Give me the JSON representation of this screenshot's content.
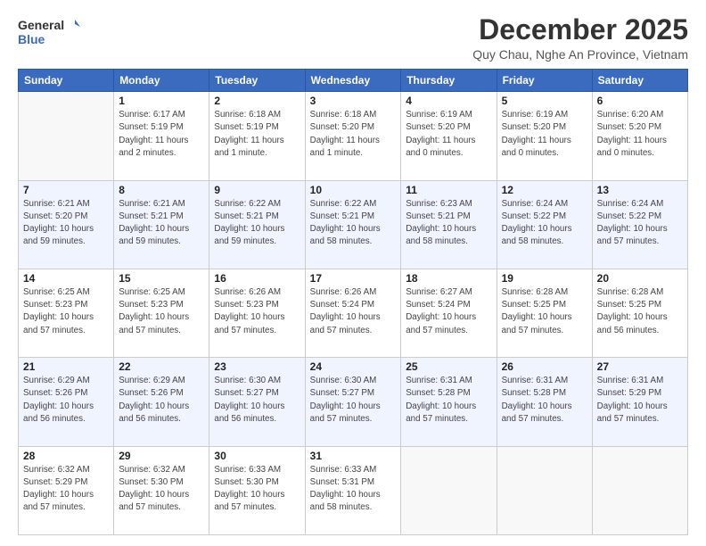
{
  "logo": {
    "line1": "General",
    "line2": "Blue"
  },
  "title": "December 2025",
  "subtitle": "Quy Chau, Nghe An Province, Vietnam",
  "days_header": [
    "Sunday",
    "Monday",
    "Tuesday",
    "Wednesday",
    "Thursday",
    "Friday",
    "Saturday"
  ],
  "weeks": [
    [
      {
        "num": "",
        "info": ""
      },
      {
        "num": "1",
        "info": "Sunrise: 6:17 AM\nSunset: 5:19 PM\nDaylight: 11 hours\nand 2 minutes."
      },
      {
        "num": "2",
        "info": "Sunrise: 6:18 AM\nSunset: 5:19 PM\nDaylight: 11 hours\nand 1 minute."
      },
      {
        "num": "3",
        "info": "Sunrise: 6:18 AM\nSunset: 5:20 PM\nDaylight: 11 hours\nand 1 minute."
      },
      {
        "num": "4",
        "info": "Sunrise: 6:19 AM\nSunset: 5:20 PM\nDaylight: 11 hours\nand 0 minutes."
      },
      {
        "num": "5",
        "info": "Sunrise: 6:19 AM\nSunset: 5:20 PM\nDaylight: 11 hours\nand 0 minutes."
      },
      {
        "num": "6",
        "info": "Sunrise: 6:20 AM\nSunset: 5:20 PM\nDaylight: 11 hours\nand 0 minutes."
      }
    ],
    [
      {
        "num": "7",
        "info": "Sunrise: 6:21 AM\nSunset: 5:20 PM\nDaylight: 10 hours\nand 59 minutes."
      },
      {
        "num": "8",
        "info": "Sunrise: 6:21 AM\nSunset: 5:21 PM\nDaylight: 10 hours\nand 59 minutes."
      },
      {
        "num": "9",
        "info": "Sunrise: 6:22 AM\nSunset: 5:21 PM\nDaylight: 10 hours\nand 59 minutes."
      },
      {
        "num": "10",
        "info": "Sunrise: 6:22 AM\nSunset: 5:21 PM\nDaylight: 10 hours\nand 58 minutes."
      },
      {
        "num": "11",
        "info": "Sunrise: 6:23 AM\nSunset: 5:21 PM\nDaylight: 10 hours\nand 58 minutes."
      },
      {
        "num": "12",
        "info": "Sunrise: 6:24 AM\nSunset: 5:22 PM\nDaylight: 10 hours\nand 58 minutes."
      },
      {
        "num": "13",
        "info": "Sunrise: 6:24 AM\nSunset: 5:22 PM\nDaylight: 10 hours\nand 57 minutes."
      }
    ],
    [
      {
        "num": "14",
        "info": "Sunrise: 6:25 AM\nSunset: 5:23 PM\nDaylight: 10 hours\nand 57 minutes."
      },
      {
        "num": "15",
        "info": "Sunrise: 6:25 AM\nSunset: 5:23 PM\nDaylight: 10 hours\nand 57 minutes."
      },
      {
        "num": "16",
        "info": "Sunrise: 6:26 AM\nSunset: 5:23 PM\nDaylight: 10 hours\nand 57 minutes."
      },
      {
        "num": "17",
        "info": "Sunrise: 6:26 AM\nSunset: 5:24 PM\nDaylight: 10 hours\nand 57 minutes."
      },
      {
        "num": "18",
        "info": "Sunrise: 6:27 AM\nSunset: 5:24 PM\nDaylight: 10 hours\nand 57 minutes."
      },
      {
        "num": "19",
        "info": "Sunrise: 6:28 AM\nSunset: 5:25 PM\nDaylight: 10 hours\nand 57 minutes."
      },
      {
        "num": "20",
        "info": "Sunrise: 6:28 AM\nSunset: 5:25 PM\nDaylight: 10 hours\nand 56 minutes."
      }
    ],
    [
      {
        "num": "21",
        "info": "Sunrise: 6:29 AM\nSunset: 5:26 PM\nDaylight: 10 hours\nand 56 minutes."
      },
      {
        "num": "22",
        "info": "Sunrise: 6:29 AM\nSunset: 5:26 PM\nDaylight: 10 hours\nand 56 minutes."
      },
      {
        "num": "23",
        "info": "Sunrise: 6:30 AM\nSunset: 5:27 PM\nDaylight: 10 hours\nand 56 minutes."
      },
      {
        "num": "24",
        "info": "Sunrise: 6:30 AM\nSunset: 5:27 PM\nDaylight: 10 hours\nand 57 minutes."
      },
      {
        "num": "25",
        "info": "Sunrise: 6:31 AM\nSunset: 5:28 PM\nDaylight: 10 hours\nand 57 minutes."
      },
      {
        "num": "26",
        "info": "Sunrise: 6:31 AM\nSunset: 5:28 PM\nDaylight: 10 hours\nand 57 minutes."
      },
      {
        "num": "27",
        "info": "Sunrise: 6:31 AM\nSunset: 5:29 PM\nDaylight: 10 hours\nand 57 minutes."
      }
    ],
    [
      {
        "num": "28",
        "info": "Sunrise: 6:32 AM\nSunset: 5:29 PM\nDaylight: 10 hours\nand 57 minutes."
      },
      {
        "num": "29",
        "info": "Sunrise: 6:32 AM\nSunset: 5:30 PM\nDaylight: 10 hours\nand 57 minutes."
      },
      {
        "num": "30",
        "info": "Sunrise: 6:33 AM\nSunset: 5:30 PM\nDaylight: 10 hours\nand 57 minutes."
      },
      {
        "num": "31",
        "info": "Sunrise: 6:33 AM\nSunset: 5:31 PM\nDaylight: 10 hours\nand 58 minutes."
      },
      {
        "num": "",
        "info": ""
      },
      {
        "num": "",
        "info": ""
      },
      {
        "num": "",
        "info": ""
      }
    ]
  ]
}
